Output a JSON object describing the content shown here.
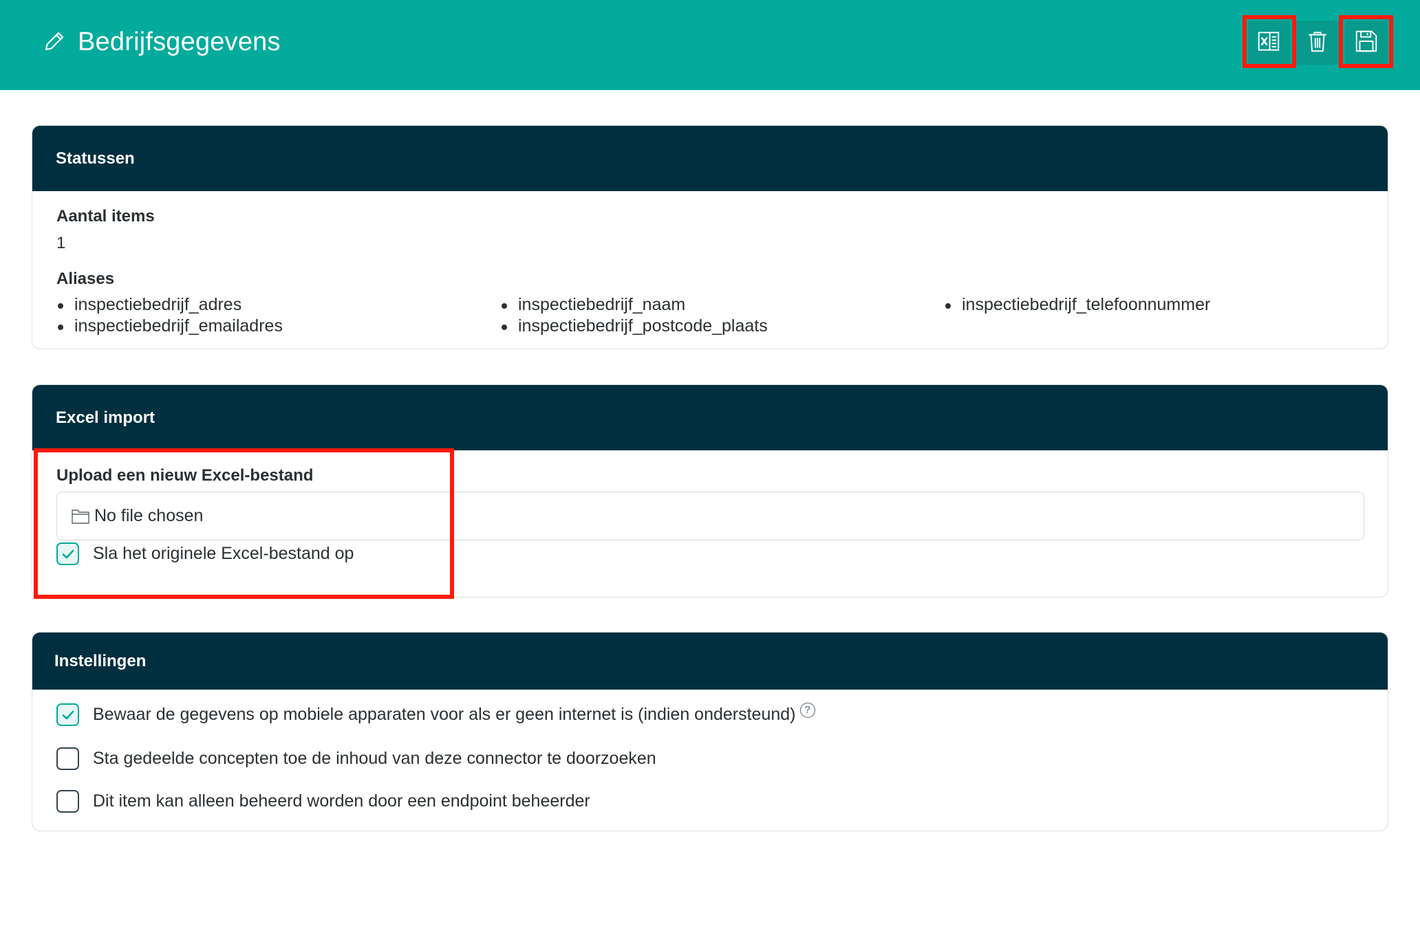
{
  "header": {
    "title": "Bedrijfsgegevens",
    "icons": {
      "edit": "pencil-icon",
      "excel": "excel-file-icon",
      "delete": "trash-icon",
      "save": "floppy-disk-icon"
    },
    "highlighted_buttons": [
      "excel",
      "save"
    ]
  },
  "colors": {
    "header_bg": "#02ab9c",
    "card_header_bg": "#002f3f",
    "accent": "#02ab9c",
    "highlight": "#ff1b0a"
  },
  "statussen": {
    "title": "Statussen",
    "items_label": "Aantal items",
    "items_value": "1",
    "aliases_label": "Aliases",
    "aliases": [
      "inspectiebedrijf_adres",
      "inspectiebedrijf_emailadres",
      "inspectiebedrijf_naam",
      "inspectiebedrijf_postcode_plaats",
      "inspectiebedrijf_telefoonnummer"
    ]
  },
  "excel_import": {
    "title": "Excel import",
    "upload_label": "Upload een nieuw Excel-bestand",
    "file_placeholder": "No file chosen",
    "keep_original_label": "Sla het originele Excel-bestand op",
    "keep_original_checked": true
  },
  "instellingen": {
    "title": "Instellingen",
    "options": [
      {
        "label": "Bewaar de gegevens op mobiele apparaten voor als er geen internet is (indien ondersteund)",
        "checked": true,
        "help": "?"
      },
      {
        "label": "Sta gedeelde concepten toe de inhoud van deze connector te doorzoeken",
        "checked": false
      },
      {
        "label": "Dit item kan alleen beheerd worden door een endpoint beheerder",
        "checked": false
      }
    ]
  }
}
